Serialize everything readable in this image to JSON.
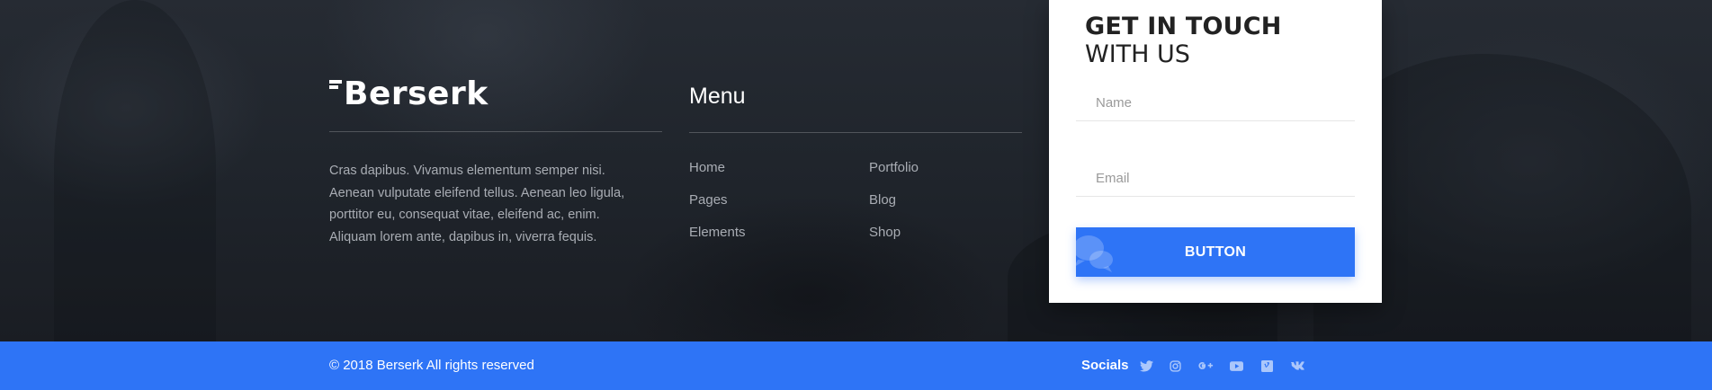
{
  "brand": {
    "name": "Berserk"
  },
  "about": {
    "text": "Cras dapibus. Vivamus elementum semper nisi. Aenean vulputate eleifend tellus. Aenean leo ligula, porttitor eu, consequat vitae, eleifend ac, enim. Aliquam lorem ante, dapibus in, viverra fequis."
  },
  "menu": {
    "title": "Menu",
    "links": [
      "Home",
      "Portfolio",
      "Pages",
      "Blog",
      "Elements",
      "Shop"
    ]
  },
  "contact": {
    "title_bold": "GET IN TOUCH",
    "title_light": "WITH US",
    "name_placeholder": "Name",
    "email_placeholder": "Email",
    "button_label": "BUTTON",
    "button_icon": "chat-bubbles-icon"
  },
  "bottom_bar": {
    "copyright": "© 2018 Berserk All rights reserved",
    "socials_label": "Socials",
    "social_icons": [
      "twitter-icon",
      "instagram-icon",
      "google-plus-icon",
      "youtube-icon",
      "vimeo-icon",
      "vk-icon"
    ]
  },
  "colors": {
    "accent": "#2e74f6",
    "footer_bg": "#1f242b",
    "text_muted": "#a9adb4",
    "white": "#ffffff"
  }
}
